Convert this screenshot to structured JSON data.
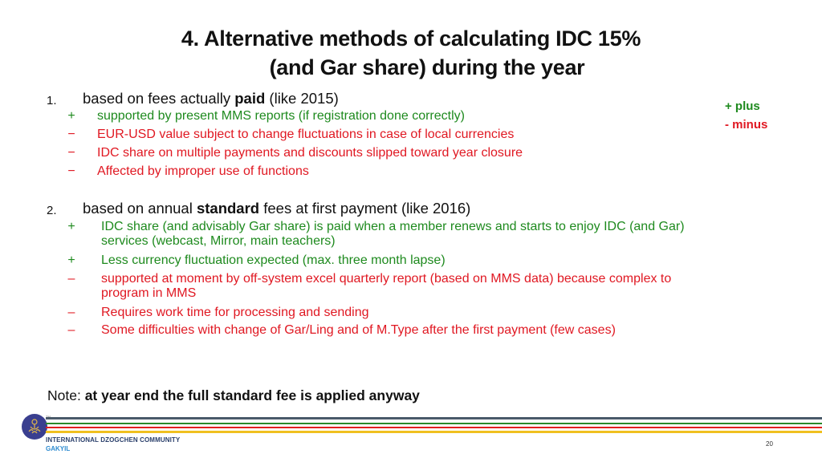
{
  "slide": {
    "title_line1": "4. Alternative methods of calculating  IDC 15%",
    "title_line2": "(and Gar share) during the year",
    "legend": {
      "plus": "+ plus",
      "minus": "-  minus"
    },
    "sections": [
      {
        "number": "1.",
        "text_before": "based on fees actually ",
        "text_bold": "paid",
        "text_after": " (like 2015)",
        "items": [
          {
            "sign": "+",
            "type": "pro",
            "text": "supported by present MMS reports (if registration done correctly)"
          },
          {
            "sign": "−",
            "type": "con",
            "text": "EUR-USD value subject to change fluctuations in case of local currencies"
          },
          {
            "sign": "−",
            "type": "con",
            "text": "IDC share on multiple payments and discounts slipped toward year closure"
          },
          {
            "sign": "−",
            "type": "con",
            "text": "Affected by improper use of functions"
          }
        ]
      },
      {
        "number": "2.",
        "text_before": "based on annual ",
        "text_bold": "standard",
        "text_after": " fees at first payment (like 2016)",
        "items": [
          {
            "sign": "+",
            "type": "pro",
            "text": "IDC share (and advisably Gar share) is paid when a member renews and starts to enjoy IDC (and Gar)",
            "text2": "services (webcast, Mirror, main teachers)"
          },
          {
            "sign": "+",
            "type": "pro",
            "text": "Less currency fluctuation expected (max. three month lapse)"
          },
          {
            "sign": "–",
            "type": "con",
            "text": "supported at moment by off-system excel quarterly report (based on MMS data) because complex to",
            "text2": "program in MMS"
          },
          {
            "sign": "–",
            "type": "con",
            "text": "Requires work time for processing and sending"
          },
          {
            "sign": "–",
            "type": "con",
            "text": "Some difficulties with change of  Gar/Ling and of M.Type  after the first payment (few cases)"
          }
        ]
      }
    ],
    "note_label": "Note: ",
    "note_bold": "at year end the full standard fee is applied anyway"
  },
  "footer": {
    "tm": "TM",
    "org_name": "INTERNATIONAL DZOGCHEN COMMUNITY",
    "org_sub": "GAKYIL",
    "page_number": "20",
    "stripe_colors": [
      "#4a5a6a",
      "#2a8a2a",
      "#e02020",
      "#f0c020"
    ]
  }
}
